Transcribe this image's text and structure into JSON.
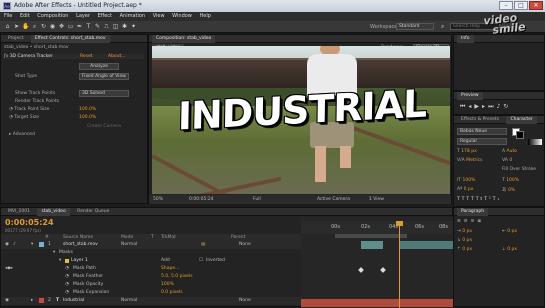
{
  "app": {
    "title": "Adobe After Effects - Untitled Project.aep *",
    "icon_text": "Ae"
  },
  "window_controls": {
    "minimize": "–",
    "maximize": "□",
    "close": "✕"
  },
  "menu": [
    "File",
    "Edit",
    "Composition",
    "Layer",
    "Effect",
    "Animation",
    "View",
    "Window",
    "Help"
  ],
  "toolbar": {
    "workspace_label": "Workspace:",
    "workspace_value": "Standard",
    "search_placeholder": "Search Help"
  },
  "project_panel": {
    "tabs": [
      "Project",
      "Effect Controls: short_stab.mov"
    ],
    "breadcrumb": "stab_video • short_stab.mov",
    "effect": {
      "name": "3D Camera Tracker",
      "reset": "Reset",
      "about": "About...",
      "analyze": "Analyze"
    },
    "rows": [
      {
        "label": "Shot Type",
        "value": "Fixed Angle of View"
      },
      {
        "label": "Show Track Points",
        "value": "3D Solved"
      },
      {
        "label": "Render Track Points",
        "value": ""
      },
      {
        "label": "Track Point Size",
        "value": "100.0%"
      },
      {
        "label": "Target Size",
        "value": "100.0%"
      },
      {
        "label": "Create Camera",
        "value": ""
      },
      {
        "label": "Advanced",
        "value": ""
      }
    ]
  },
  "comp_panel": {
    "tab": "Composition: stab_video",
    "sub_tab": "stab_video",
    "renderer_label": "Renderer:",
    "renderer_value": "Classic 3D",
    "footer": {
      "zoom": "50%",
      "timecode": "0:00:05:24",
      "quality": "Full",
      "camera": "Active Camera",
      "view": "1 View"
    }
  },
  "video": {
    "overlay_text": "INDUSTRIAL"
  },
  "info_panel": {
    "title": "Info"
  },
  "watermark": {
    "line1": "video",
    "line2": "smile"
  },
  "preview_panel": {
    "title": "Preview"
  },
  "character_panel": {
    "tabs": [
      "Effects & Presets",
      "Character"
    ],
    "font": "Bebas Neue",
    "style": "Regular",
    "size": "178 px",
    "leading": "Auto",
    "kerning": "Metrics",
    "tracking": "0",
    "stroke": "Fill Over Stroke",
    "vscale": "100%",
    "hscale": "100%",
    "baseline": "0 px",
    "tsume": "0%"
  },
  "paragraph_panel": {
    "title": "Paragraph",
    "values": [
      "0 px",
      "0 px",
      "0 px",
      "0 px",
      "0 px"
    ]
  },
  "timeline": {
    "tabs": [
      "MVI_1001",
      "stab_video",
      "Render Queue"
    ],
    "timecode": "0:00:05:24",
    "frame_info": "00177 (29.97 fps)",
    "columns": [
      "#",
      "Source Name",
      "Mode",
      "T",
      "TrkMat",
      "Parent"
    ],
    "ruler": [
      "00s",
      "02s",
      "04s",
      "06s",
      "08s"
    ],
    "layers": [
      {
        "num": "1",
        "name": "short_stab.mov",
        "mode": "Normal",
        "parent": "None"
      },
      {
        "num": "",
        "name": "Masks",
        "mode": "",
        "parent": ""
      },
      {
        "num": "",
        "name": "Layer 1",
        "mode": "Add",
        "parent": "Inverted"
      },
      {
        "num": "",
        "name": "Mask Path",
        "mode": "",
        "parent": "Shape..."
      },
      {
        "num": "",
        "name": "Mask Feather",
        "mode": "",
        "parent": "5.0, 5.0 pixels"
      },
      {
        "num": "",
        "name": "Mask Opacity",
        "mode": "",
        "parent": "100%"
      },
      {
        "num": "",
        "name": "Mask Expansion",
        "mode": "",
        "parent": "0.0 pixels"
      },
      {
        "num": "2",
        "name": "Industrial",
        "mode": "Normal",
        "parent": "None"
      }
    ]
  },
  "colors": {
    "accent": "#e39a2c",
    "selection": "#5fa0d6",
    "title_bar": "#d3dce6",
    "panel_bg": "#232323"
  }
}
